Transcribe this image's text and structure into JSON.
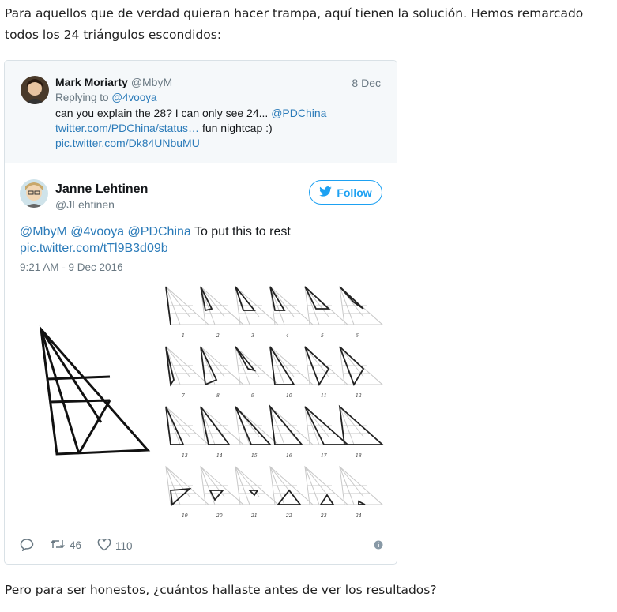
{
  "article": {
    "intro": "Para aquellos que de verdad quieran hacer trampa, aquí tienen la solución. Hemos remarcado todos los 24 triángulos escondidos:",
    "outro": "Pero para ser honestos, ¿cuántos hallaste antes de ver los resultados?"
  },
  "quoted_tweet": {
    "name": "Mark Moriarty",
    "handle": "@MbyM",
    "date": "8 Dec",
    "replying_prefix": "Replying to",
    "replying_to": "@4vooya",
    "text_1": "can you explain the 28? I can only see 24...",
    "mention": "@PDChina",
    "link_1": "twitter.com/PDChina/status…",
    "text_2": "fun nightcap :)",
    "link_2": "pic.twitter.com/Dk84UNbuMU"
  },
  "tweet": {
    "name": "Janne Lehtinen",
    "handle": "@JLehtinen",
    "follow_label": "Follow",
    "mentions": "@MbyM @4vooya @PDChina",
    "text": "To put this to rest",
    "link": "pic.twitter.com/tTl9B3d09b",
    "timestamp": "9:21 AM - 9 Dec 2016",
    "retweets": "46",
    "likes": "110"
  },
  "figure_numbers": [
    "1",
    "2",
    "3",
    "4",
    "5",
    "6",
    "7",
    "8",
    "9",
    "10",
    "11",
    "12",
    "13",
    "14",
    "15",
    "16",
    "17",
    "18",
    "19",
    "20",
    "21",
    "22",
    "23",
    "24"
  ],
  "colors": {
    "link": "#2b7bb9",
    "twitter_blue": "#1da1f2",
    "muted": "#697882"
  }
}
